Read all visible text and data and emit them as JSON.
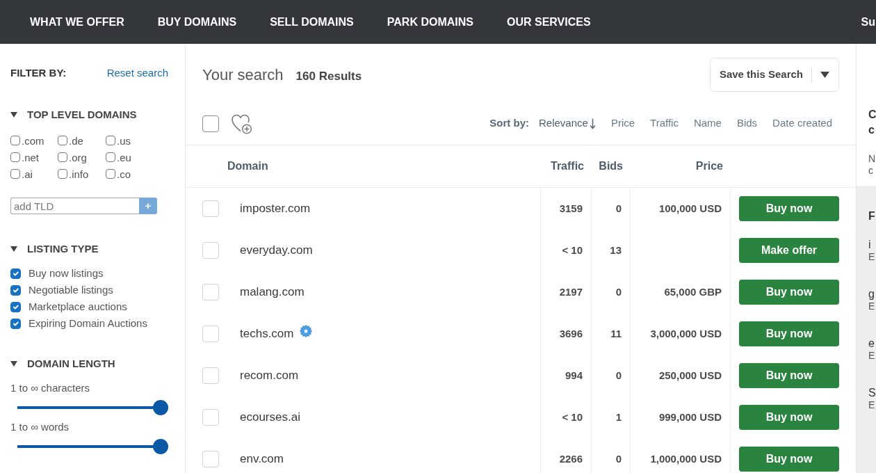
{
  "nav": {
    "items": [
      "WHAT WE OFFER",
      "BUY DOMAINS",
      "SELL DOMAINS",
      "PARK DOMAINS",
      "OUR SERVICES"
    ],
    "edge_item": "Su"
  },
  "sidebar": {
    "title": "FILTER BY:",
    "reset_link": "Reset search",
    "sections": [
      {
        "kind": "tld_grid",
        "title": "TOP LEVEL DOMAINS",
        "expanded": true,
        "options": [
          {
            "label": ".com",
            "checked": false
          },
          {
            "label": ".de",
            "checked": false
          },
          {
            "label": ".us",
            "checked": false
          },
          {
            "label": ".net",
            "checked": false
          },
          {
            "label": ".org",
            "checked": false
          },
          {
            "label": ".eu",
            "checked": false
          },
          {
            "label": ".ai",
            "checked": false
          },
          {
            "label": ".info",
            "checked": false
          },
          {
            "label": ".co",
            "checked": false
          }
        ],
        "add_field": {
          "placeholder": "add TLD",
          "button": "+"
        }
      },
      {
        "kind": "checklist",
        "title": "LISTING TYPE",
        "expanded": true,
        "options": [
          {
            "label": "Buy now listings",
            "checked": true
          },
          {
            "label": "Negotiable listings",
            "checked": true
          },
          {
            "label": "Marketplace auctions",
            "checked": true
          },
          {
            "label": "Expiring Domain Auctions",
            "checked": true
          }
        ]
      },
      {
        "kind": "sliders",
        "title": "DOMAIN LENGTH",
        "expanded": true,
        "sliders": [
          {
            "label": "1 to ∞ characters",
            "level": 1
          },
          {
            "label": "1 to ∞ words",
            "level": 1
          }
        ]
      }
    ]
  },
  "results": {
    "title": "Your search",
    "count": "160 Results",
    "save_button": "Save this Search",
    "select_all": {
      "checked": false
    },
    "sort": {
      "label": "Sort by:",
      "options": [
        {
          "label": "Relevance",
          "selected": true
        },
        {
          "label": "Price",
          "selected": false
        },
        {
          "label": "Traffic",
          "selected": false
        },
        {
          "label": "Name",
          "selected": false
        },
        {
          "label": "Bids",
          "selected": false
        },
        {
          "label": "Date created",
          "selected": false
        }
      ]
    },
    "table": {
      "columns": [
        "Domain",
        "Traffic",
        "Bids",
        "Price"
      ],
      "rows": [
        {
          "checked": false,
          "domain": "imposter.com",
          "seal": false,
          "traffic": "3159",
          "bids": "0",
          "price": "100,000 USD",
          "action": "Buy now"
        },
        {
          "checked": false,
          "domain": "everyday.com",
          "seal": false,
          "traffic": "< 10",
          "bids": "13",
          "action": "Make offer"
        },
        {
          "checked": false,
          "domain": "malang.com",
          "seal": false,
          "traffic": "2197",
          "bids": "0",
          "price": "65,000 GBP",
          "action": "Buy now"
        },
        {
          "checked": false,
          "domain": "techs.com",
          "seal": true,
          "traffic": "3696",
          "bids": "11",
          "price": "3,000,000 USD",
          "action": "Buy now"
        },
        {
          "checked": false,
          "domain": "recom.com",
          "seal": false,
          "traffic": "994",
          "bids": "0",
          "price": "250,000 USD",
          "action": "Buy now"
        },
        {
          "checked": false,
          "domain": "ecourses.ai",
          "seal": false,
          "traffic": "< 10",
          "bids": "1",
          "price": "999,000 USD",
          "action": "Buy now"
        },
        {
          "checked": false,
          "domain": "env.com",
          "seal": false,
          "traffic": "2266",
          "bids": "0",
          "price": "1,000,000 USD",
          "action": "Buy now"
        }
      ]
    }
  },
  "right_panel": {
    "heading_lines": [
      "C",
      "c"
    ],
    "text_lines": [
      "N",
      "c"
    ],
    "list": {
      "heading": "F",
      "items": [
        {
          "title": "i",
          "subtitle": "E"
        },
        {
          "title": "g",
          "subtitle": "E"
        },
        {
          "title": "e",
          "subtitle": "E"
        },
        {
          "title": "S",
          "subtitle": "E"
        }
      ]
    }
  }
}
